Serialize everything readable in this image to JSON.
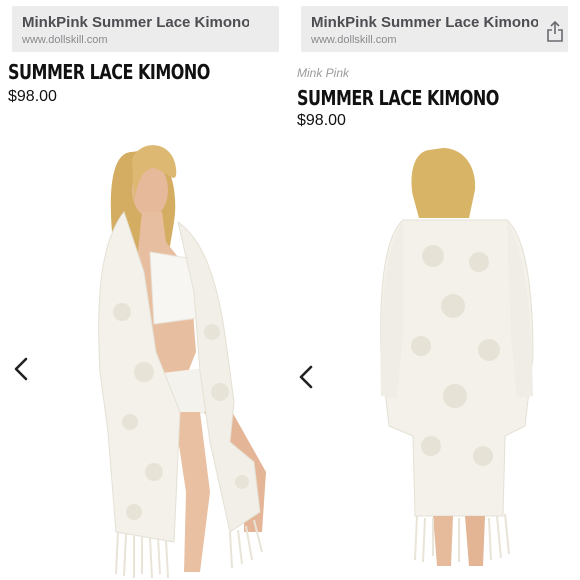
{
  "screens": [
    {
      "url_bar": {
        "title": "MinkPink Summer Lace Kimono...",
        "url": "www.dollskill.com"
      },
      "product": {
        "title": "SUMMER LACE KIMONO",
        "price": "$98.00"
      },
      "image": {
        "alt": "model front view"
      },
      "nav": {
        "prev_icon": "chevron-left-icon"
      }
    },
    {
      "url_bar": {
        "title": "MinkPink Summer Lace Kimono...",
        "url": "www.dollskill.com",
        "share_icon": "share-icon"
      },
      "product": {
        "brand": "Mink Pink",
        "title": "SUMMER LACE KIMONO",
        "price": "$98.00"
      },
      "image": {
        "alt": "model back view"
      },
      "nav": {
        "prev_icon": "chevron-left-icon"
      }
    }
  ],
  "colors": {
    "url_bar_bg": "#ececed",
    "title_text": "#4d4d52",
    "url_text": "#8a8a8f",
    "kimono": "#f3f1ea",
    "hair": "#d9b56a",
    "skin": "#e6b99a"
  }
}
